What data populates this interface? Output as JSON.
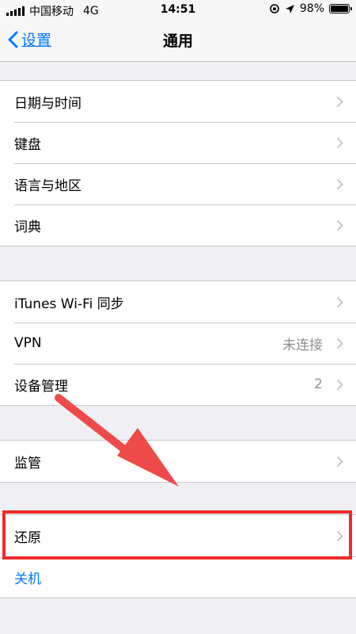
{
  "status_bar": {
    "carrier": "中国移动",
    "network": "4G",
    "time": "14:51",
    "battery": "98%",
    "battery_level": 0.98
  },
  "nav": {
    "back_label": "设置",
    "title": "通用"
  },
  "groups": [
    {
      "items": [
        {
          "label": "日期与时间"
        },
        {
          "label": "键盘"
        },
        {
          "label": "语言与地区"
        },
        {
          "label": "词典"
        }
      ]
    },
    {
      "items": [
        {
          "label": "iTunes Wi-Fi 同步"
        },
        {
          "label": "VPN",
          "value": "未连接"
        },
        {
          "label": "设备管理",
          "value": "2"
        }
      ]
    },
    {
      "items": [
        {
          "label": "监管"
        }
      ]
    },
    {
      "items": [
        {
          "label": "还原"
        },
        {
          "label": "关机"
        }
      ]
    }
  ],
  "colors": {
    "accent": "#007aff",
    "highlight": "#ee2a2a",
    "background": "#efeff4"
  }
}
